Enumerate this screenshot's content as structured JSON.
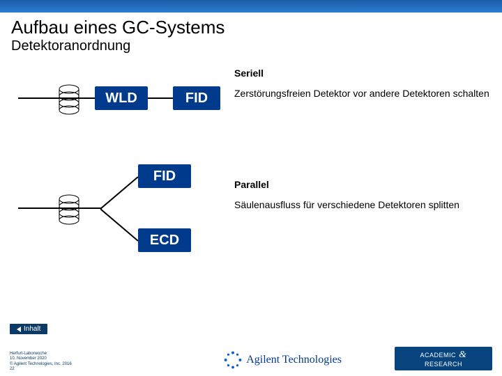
{
  "title": "Aufbau eines GC-Systems",
  "subtitle": "Detektoranordnung",
  "serial": {
    "heading": "Seriell",
    "text": "Zerstörungsfreien Detektor vor andere Detektoren schalten",
    "box1": "WLD",
    "box2": "FID"
  },
  "parallel": {
    "heading": "Parallel",
    "text": "Säulenausfluss für verschiedene Detektoren splitten",
    "box1": "FID",
    "box2": "ECD"
  },
  "nav": {
    "inhalt": "Inhalt"
  },
  "credits": {
    "line1": "Herfurt-Laborwoche",
    "line2": "10. November 2020",
    "line3": "© Agilent Technologies, Inc. 2016",
    "line4": "22"
  },
  "brand": {
    "main": "Agilent Technologies",
    "ar1": "ACADEMIC",
    "amp": "&",
    "ar2": "RESEARCH"
  }
}
